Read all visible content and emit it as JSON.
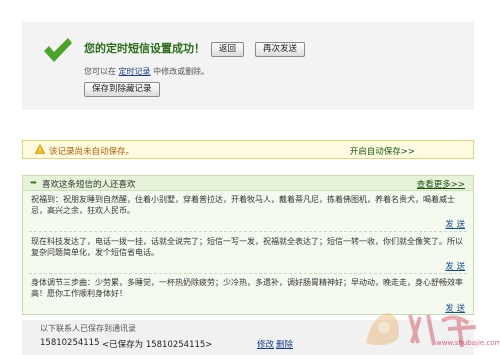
{
  "success": {
    "title": "您的定时短信设置成功！",
    "back_label": "返回",
    "resend_label": "再次发送",
    "hint_prefix": "您可以在",
    "hint_link": "定时记录",
    "hint_suffix": "中修改或删除。",
    "save_contacts_label": "保存到除藏记录"
  },
  "warning": {
    "text": "该记录尚未自动保存。",
    "autosave_label": "开启自动保存>>"
  },
  "recommend": {
    "title": "喜欢这条短信的人还喜欢",
    "more_label": "查看更多>>",
    "items": [
      {
        "text": "祝福到：祝朋友睡到自然醒，住着小别墅，穿着普拉达，开着牧马人，戴着蒂凡尼，拣着佛图机，养着名贵犬，喝着威士忌，高兴之余，狂欢人民币。",
        "send_label": "发 送"
      },
      {
        "text": "现在科技发达了，电话一拨一挂，话就全说完了；短信一写一发，祝福就全表达了；短信一转一收，你们就全像笑了。所以复杂问题简单化，发个短信省电话。",
        "send_label": "发 送"
      },
      {
        "text": "身体调节三步曲：少劳累，多睡觉，一杯热奶除疲劳；少冷热，多遗补，调好肠胃精神好；早动动，晚走走，身心舒畅效率高！愿你工作顺利身体好！",
        "send_label": "发 送"
      }
    ]
  },
  "history": {
    "label": "以下联系人已保存到通讯录",
    "number": "15810254115",
    "saved_as": "<已保存为 15810254115>",
    "edit_label": "修改",
    "delete_label": "删除"
  },
  "watermark": {
    "url": "www.shubajie.com"
  },
  "colors": {
    "success_green": "#2c6d19",
    "warning_orange": "#b75d06",
    "link_blue": "#1a3e8c"
  }
}
